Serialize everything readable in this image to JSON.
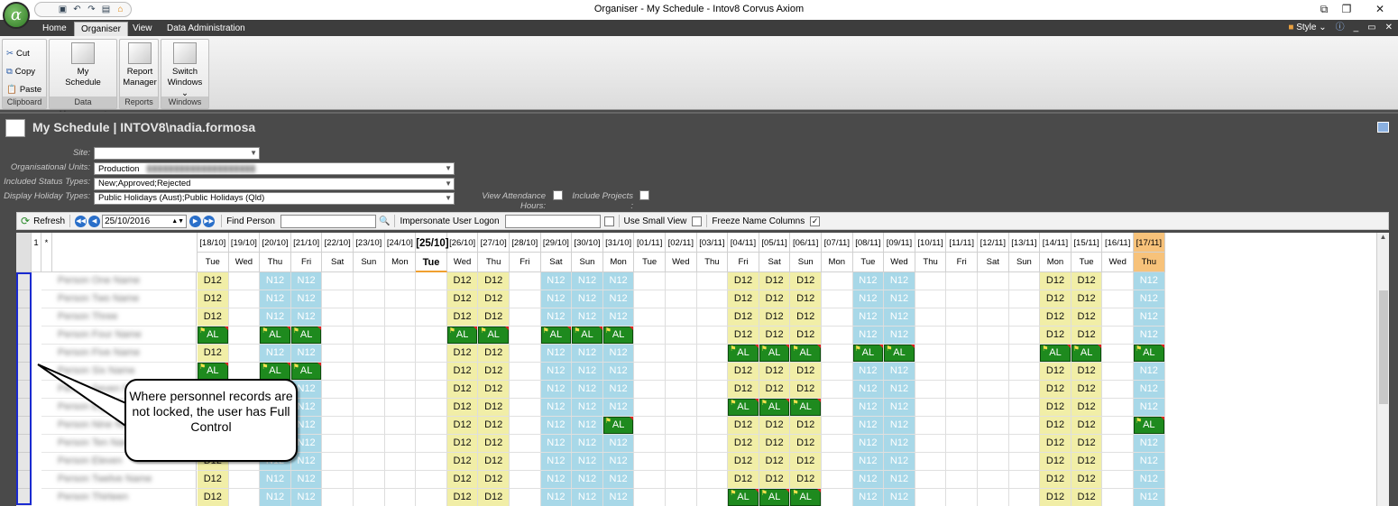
{
  "window": {
    "title": "Organiser - My Schedule - Intov8 Corvus Axiom",
    "orb_glyph": "α"
  },
  "ribbon_tabs": [
    "Home",
    "Organiser",
    "View",
    "Data Administration"
  ],
  "style_menu": {
    "label": "Style"
  },
  "ribbon": {
    "clipboard": {
      "label": "Clipboard",
      "cut": "Cut",
      "copy": "Copy",
      "paste": "Paste"
    },
    "data_management": {
      "label": "Data Management",
      "button": "My Schedule"
    },
    "reports": {
      "label": "Reports",
      "button": "Report Manager"
    },
    "windows": {
      "label": "Windows",
      "button": "Switch Windows"
    }
  },
  "page": {
    "title": "My Schedule | INTOV8\\nadia.formosa"
  },
  "filters": {
    "site_label": "Site:",
    "site_value": "",
    "org_units_label": "Organisational Units:",
    "org_units_value": "Production",
    "status_label": "Included Status Types:",
    "status_value": "New;Approved;Rejected",
    "holiday_label": "Display Holiday Types:",
    "holiday_value": "Public Holidays (Aust);Public Holidays (Qld)",
    "attendance_label": "View Attendance Hours:",
    "projects_label": "Include Projects :"
  },
  "toolbar": {
    "refresh": "Refresh",
    "date": "25/10/2016",
    "find_person": "Find Person",
    "impersonate": "Impersonate User Logon",
    "small_view": "Use Small View",
    "freeze": "Freeze Name Columns"
  },
  "grid": {
    "corner": [
      "1",
      "*"
    ],
    "dates": [
      "[18/10]",
      "[19/10]",
      "[20/10]",
      "[21/10]",
      "[22/10]",
      "[23/10]",
      "[24/10]",
      "[25/10]",
      "[26/10]",
      "[27/10]",
      "[28/10]",
      "[29/10]",
      "[30/10]",
      "[31/10]",
      "[01/11]",
      "[02/11]",
      "[03/11]",
      "[04/11]",
      "[05/11]",
      "[06/11]",
      "[07/11]",
      "[08/11]",
      "[09/11]",
      "[10/11]",
      "[11/11]",
      "[12/11]",
      "[13/11]",
      "[14/11]",
      "[15/11]",
      "[16/11]",
      "[17/11]"
    ],
    "days": [
      "Tue",
      "Wed",
      "Thu",
      "Fri",
      "Sat",
      "Sun",
      "Mon",
      "Tue",
      "Wed",
      "Thu",
      "Fri",
      "Sat",
      "Sun",
      "Mon",
      "Tue",
      "Wed",
      "Thu",
      "Fri",
      "Sat",
      "Sun",
      "Mon",
      "Tue",
      "Wed",
      "Thu",
      "Fri",
      "Sat",
      "Sun",
      "Mon",
      "Tue",
      "Wed",
      "Thu"
    ],
    "today_index": 7,
    "highlight_index": 30,
    "rows": [
      {
        "name": "Person One Name",
        "cells": [
          "D12",
          "",
          "N12",
          "N12",
          "",
          "",
          "",
          "",
          "D12",
          "D12",
          "",
          "N12",
          "N12",
          "N12",
          "",
          "",
          "",
          "D12",
          "D12",
          "D12",
          "",
          "N12",
          "N12",
          "",
          "",
          "",
          "",
          "D12",
          "D12",
          "",
          "N12"
        ]
      },
      {
        "name": "Person Two Name",
        "cells": [
          "D12",
          "",
          "N12",
          "N12",
          "",
          "",
          "",
          "",
          "D12",
          "D12",
          "",
          "N12",
          "N12",
          "N12",
          "",
          "",
          "",
          "D12",
          "D12",
          "D12",
          "",
          "N12",
          "N12",
          "",
          "",
          "",
          "",
          "D12",
          "D12",
          "",
          "N12"
        ]
      },
      {
        "name": "Person Three",
        "cells": [
          "D12",
          "",
          "N12",
          "N12",
          "",
          "",
          "",
          "",
          "D12",
          "D12",
          "",
          "N12",
          "N12",
          "N12",
          "",
          "",
          "",
          "D12",
          "D12",
          "D12",
          "",
          "N12",
          "N12",
          "",
          "",
          "",
          "",
          "D12",
          "D12",
          "",
          "N12"
        ]
      },
      {
        "name": "Person Four Name",
        "cells": [
          "AL",
          "",
          "AL",
          "AL",
          "",
          "",
          "",
          "",
          "AL",
          "AL",
          "",
          "AL",
          "AL",
          "AL",
          "",
          "",
          "",
          "D12",
          "D12",
          "D12",
          "",
          "N12",
          "N12",
          "",
          "",
          "",
          "",
          "D12",
          "D12",
          "",
          "N12"
        ]
      },
      {
        "name": "Person Five Name",
        "cells": [
          "D12",
          "",
          "N12",
          "N12",
          "",
          "",
          "",
          "",
          "D12",
          "D12",
          "",
          "N12",
          "N12",
          "N12",
          "",
          "",
          "",
          "AL",
          "AL",
          "AL",
          "",
          "AL",
          "AL",
          "",
          "",
          "",
          "",
          "AL",
          "AL",
          "",
          "AL"
        ]
      },
      {
        "name": "Person Six Name",
        "cells": [
          "AL",
          "",
          "AL",
          "AL",
          "",
          "",
          "",
          "",
          "D12",
          "D12",
          "",
          "N12",
          "N12",
          "N12",
          "",
          "",
          "",
          "D12",
          "D12",
          "D12",
          "",
          "N12",
          "N12",
          "",
          "",
          "",
          "",
          "D12",
          "D12",
          "",
          "N12"
        ]
      },
      {
        "name": "Person Seven Name",
        "cells": [
          "D12",
          "",
          "N12",
          "N12",
          "",
          "",
          "",
          "",
          "D12",
          "D12",
          "",
          "N12",
          "N12",
          "N12",
          "",
          "",
          "",
          "D12",
          "D12",
          "D12",
          "",
          "N12",
          "N12",
          "",
          "",
          "",
          "",
          "D12",
          "D12",
          "",
          "N12"
        ]
      },
      {
        "name": "Person Eight Name",
        "cells": [
          "D12",
          "",
          "N12",
          "N12",
          "",
          "",
          "",
          "",
          "D12",
          "D12",
          "",
          "N12",
          "N12",
          "N12",
          "",
          "",
          "",
          "AL",
          "AL",
          "AL",
          "",
          "N12",
          "N12",
          "",
          "",
          "",
          "",
          "D12",
          "D12",
          "",
          "N12"
        ]
      },
      {
        "name": "Person Nine Name",
        "cells": [
          "D12",
          "",
          "N12",
          "N12",
          "",
          "",
          "",
          "",
          "D12",
          "D12",
          "",
          "N12",
          "N12",
          "AL",
          "",
          "",
          "",
          "D12",
          "D12",
          "D12",
          "",
          "N12",
          "N12",
          "",
          "",
          "",
          "",
          "D12",
          "D12",
          "",
          "AL"
        ]
      },
      {
        "name": "Person Ten Name",
        "cells": [
          "D12",
          "",
          "N12",
          "N12",
          "",
          "",
          "",
          "",
          "D12",
          "D12",
          "",
          "N12",
          "N12",
          "N12",
          "",
          "",
          "",
          "D12",
          "D12",
          "D12",
          "",
          "N12",
          "N12",
          "",
          "",
          "",
          "",
          "D12",
          "D12",
          "",
          "N12"
        ]
      },
      {
        "name": "Person Eleven",
        "cells": [
          "D12",
          "",
          "N12",
          "N12",
          "",
          "",
          "",
          "",
          "D12",
          "D12",
          "",
          "N12",
          "N12",
          "N12",
          "",
          "",
          "",
          "D12",
          "D12",
          "D12",
          "",
          "N12",
          "N12",
          "",
          "",
          "",
          "",
          "D12",
          "D12",
          "",
          "N12"
        ]
      },
      {
        "name": "Person Twelve Name",
        "cells": [
          "D12",
          "",
          "N12",
          "N12",
          "",
          "",
          "",
          "",
          "D12",
          "D12",
          "",
          "N12",
          "N12",
          "N12",
          "",
          "",
          "",
          "D12",
          "D12",
          "D12",
          "",
          "N12",
          "N12",
          "",
          "",
          "",
          "",
          "D12",
          "D12",
          "",
          "N12"
        ]
      },
      {
        "name": "Person Thirteen",
        "cells": [
          "D12",
          "",
          "N12",
          "N12",
          "",
          "",
          "",
          "",
          "D12",
          "D12",
          "",
          "N12",
          "N12",
          "N12",
          "",
          "",
          "",
          "AL",
          "AL",
          "AL",
          "",
          "N12",
          "N12",
          "",
          "",
          "",
          "",
          "D12",
          "D12",
          "",
          "N12"
        ]
      }
    ]
  },
  "callout": {
    "text": "Where personnel records are not locked, the user has Full Control"
  },
  "colors": {
    "day_shift": "#f1eea7",
    "night_shift": "#a8d8e8",
    "leave": "#1e8a1e",
    "selection": "#1a2ad0",
    "today_header": "#f7c27a"
  }
}
